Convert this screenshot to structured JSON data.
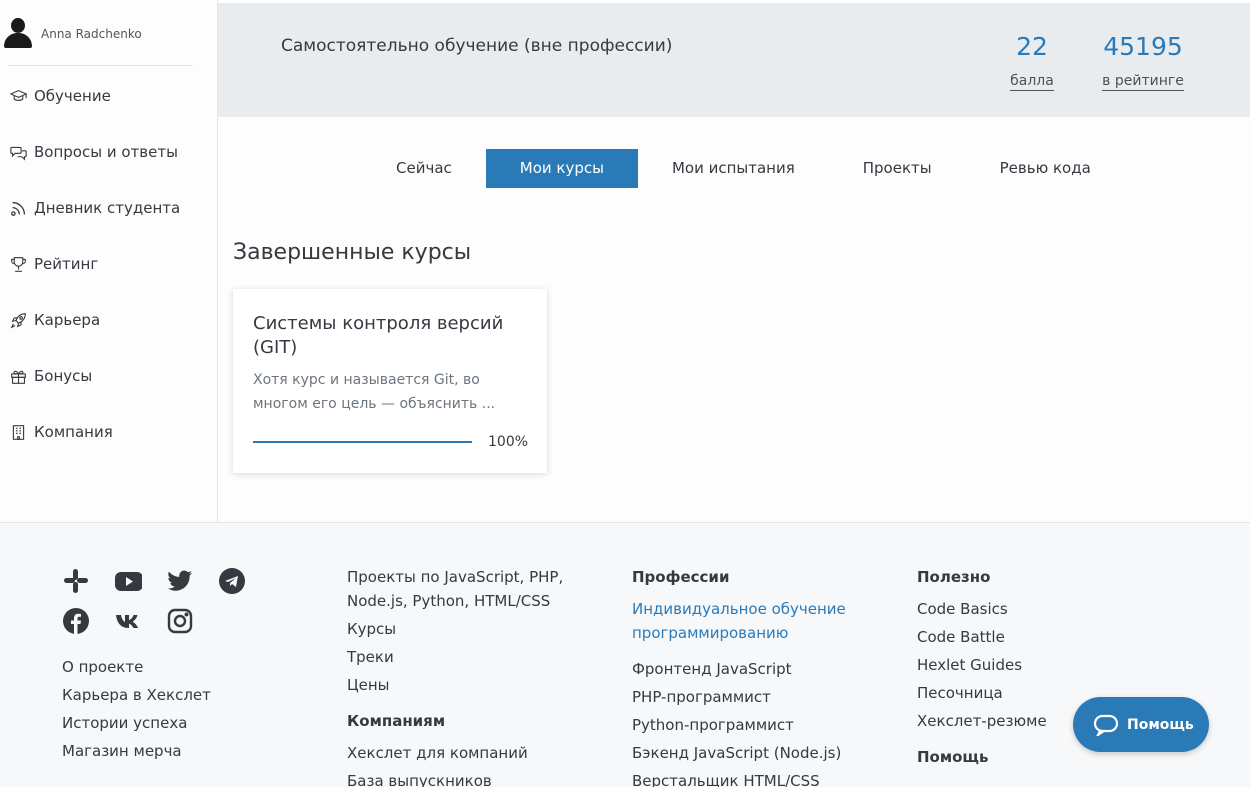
{
  "user": {
    "name": "Anna Radchenko"
  },
  "sidebar": {
    "items": [
      {
        "label": "Обучение",
        "icon": "graduation-cap-icon"
      },
      {
        "label": "Вопросы и ответы",
        "icon": "chat-bubbles-icon"
      },
      {
        "label": "Дневник студента",
        "icon": "feed-icon"
      },
      {
        "label": "Рейтинг",
        "icon": "trophy-icon"
      },
      {
        "label": "Карьера",
        "icon": "rocket-icon"
      },
      {
        "label": "Бонусы",
        "icon": "gift-icon"
      },
      {
        "label": "Компания",
        "icon": "building-icon"
      }
    ]
  },
  "header": {
    "track": "Самостоятельно обучение (вне профессии)",
    "points": {
      "value": "22",
      "label": "балла"
    },
    "rating": {
      "value": "45195",
      "label": "в рейтинге"
    }
  },
  "tabs": [
    {
      "label": "Сейчас",
      "active": false
    },
    {
      "label": "Мои курсы",
      "active": true
    },
    {
      "label": "Мои испытания",
      "active": false
    },
    {
      "label": "Проекты",
      "active": false
    },
    {
      "label": "Ревью кода",
      "active": false
    }
  ],
  "main": {
    "section_title": "Завершенные курсы",
    "course": {
      "title": "Системы контроля версий (GIT)",
      "description": "Хотя курс и называется Git, во многом его цель — объяснить ...",
      "progress_percent": 100,
      "progress_label": "100%"
    }
  },
  "footer": {
    "social_icons": [
      "slack-icon",
      "youtube-icon",
      "twitter-icon",
      "telegram-icon",
      "facebook-icon",
      "vk-icon",
      "instagram-icon"
    ],
    "col1": {
      "links": [
        "О проекте",
        "Карьера в Хекслет",
        "Истории успеха",
        "Магазин мерча"
      ]
    },
    "col2": {
      "links": [
        "Проекты по JavaScript, PHP, Node.js, Python, HTML/CSS",
        "Курсы",
        "Треки",
        "Цены"
      ],
      "head2": "Компаниям",
      "links2": [
        "Хекслет для компаний",
        "База выпускников"
      ]
    },
    "col3": {
      "head": "Профессии",
      "highlight": "Индивидуальное обучение программированию",
      "links": [
        "Фронтенд JavaScript",
        "PHP-программист",
        "Python-программист",
        "Бэкенд JavaScript (Node.js)",
        "Верстальщик HTML/CSS"
      ]
    },
    "col4": {
      "head": "Полезно",
      "links": [
        "Code Basics",
        "Code Battle",
        "Hexlet Guides",
        "Песочница",
        "Хекслет-резюме"
      ],
      "head2": "Помощь"
    }
  },
  "help_button": {
    "label": "Помощь"
  },
  "colors": {
    "accent": "#2a7ab8",
    "band": "#e9ecef",
    "footer_bg": "#f7f8f9"
  }
}
